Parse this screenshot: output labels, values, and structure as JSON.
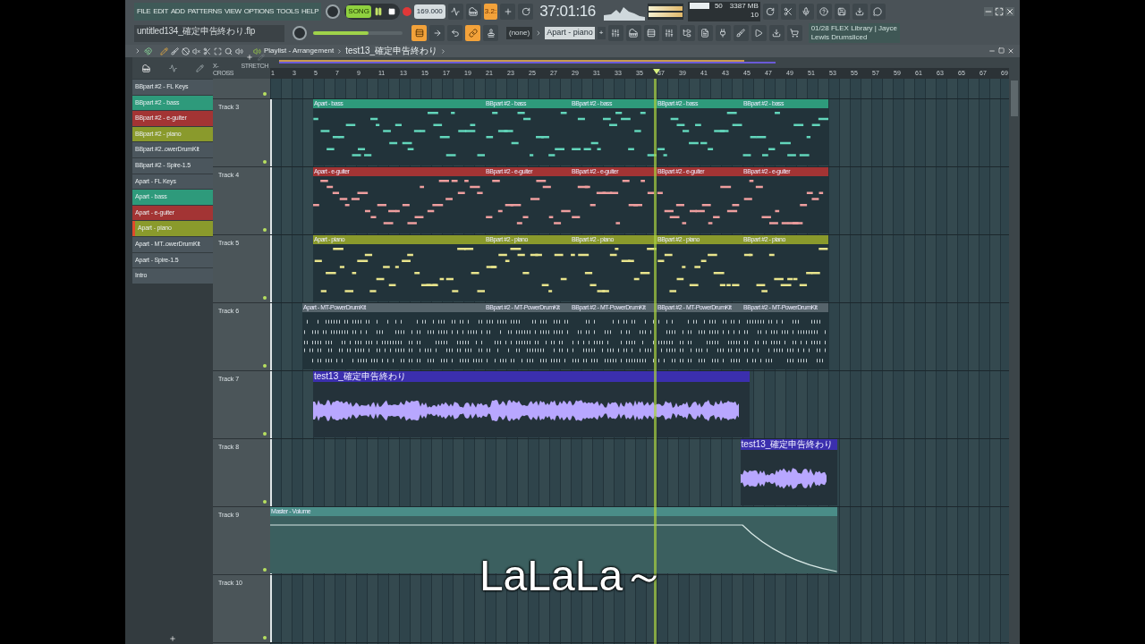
{
  "menu": [
    "FILE",
    "EDIT",
    "ADD",
    "PATTERNS",
    "VIEW",
    "OPTIONS",
    "TOOLS",
    "HELP"
  ],
  "file_name": "untitled134_確定申告終わり.flp",
  "song_mode": "SONG",
  "tempo": "169.000",
  "snap_label": "3.2:",
  "time": "37:01:16",
  "cpu": "50",
  "memory": "3387 MB",
  "polyphony": "10",
  "master_volume": {
    "level": 0.62
  },
  "snap": "(none)",
  "pattern": "Apart - piano",
  "add_pattern": "+",
  "browser_hint": [
    "01/28  FLEX Library | Jayce",
    "Lewis Drumsliced"
  ],
  "playlist": {
    "title": "Playlist - Arrangement",
    "pattern": "test13_確定申告終わり"
  },
  "crossfade": "X-CROSS",
  "stretch": "STRETCH",
  "ruler": [
    "1",
    "3",
    "5",
    "7",
    "9",
    "11",
    "13",
    "15",
    "17",
    "19",
    "21",
    "23",
    "25",
    "27",
    "29",
    "31",
    "33",
    "35",
    "37",
    "39",
    "41",
    "43",
    "45",
    "47",
    "49",
    "51",
    "53",
    "55",
    "57",
    "59",
    "61",
    "63",
    "65",
    "67",
    "69"
  ],
  "patterns": [
    {
      "name": "BBpart #2 - FL Keys",
      "color": "#4b565d",
      "selected": false
    },
    {
      "name": "BBpart #2 - bass",
      "color": "#2e9a7b",
      "selected": false
    },
    {
      "name": "BBpart #2 - e-guiter",
      "color": "#a33434",
      "selected": false
    },
    {
      "name": "BBpart #2 - piano",
      "color": "#8a9a2c",
      "selected": false
    },
    {
      "name": "BBpart #2..owerDrumKit",
      "color": "#4b565d",
      "selected": false
    },
    {
      "name": "BBpart #2 - Spire-1.5",
      "color": "#4b565d",
      "selected": false
    },
    {
      "name": "Apart - FL Keys",
      "color": "#4b565d",
      "selected": false
    },
    {
      "name": "Apart - bass",
      "color": "#2e9a7b",
      "selected": false
    },
    {
      "name": "Apart - e-guiter",
      "color": "#a33434",
      "selected": false
    },
    {
      "name": "Apart - piano",
      "color": "#8a9a2c",
      "selected": true
    },
    {
      "name": "Apart - MT..owerDrumKit",
      "color": "#4b565d",
      "selected": false
    },
    {
      "name": "Apart - Spire-1.5",
      "color": "#4b565d",
      "selected": false
    },
    {
      "name": "Intro",
      "color": "#4b565d",
      "selected": false
    }
  ],
  "tracks": [
    {
      "name": "Track 3",
      "clips": [
        {
          "kind": "notes",
          "label": "Apart - bass",
          "color": "#2e9a7b"
        },
        {
          "kind": "notes",
          "label": "BBpart #2 - bass",
          "color": "#2e9a7b"
        },
        {
          "kind": "notes",
          "label": "BBpart #2 - bass",
          "color": "#2e9a7b"
        },
        {
          "kind": "notes",
          "label": "BBpart #2 - bass",
          "color": "#2e9a7b"
        },
        {
          "kind": "notes",
          "label": "BBpart #2 - bass",
          "color": "#2e9a7b"
        }
      ]
    },
    {
      "name": "Track 4",
      "clips": [
        {
          "kind": "notes",
          "label": "Apart - e-guiter",
          "color": "#a33434"
        },
        {
          "kind": "notes",
          "label": "BBpart #2 - e-guiter",
          "color": "#a33434"
        },
        {
          "kind": "notes",
          "label": "BBpart #2 - e-guiter",
          "color": "#a33434"
        },
        {
          "kind": "notes",
          "label": "BBpart #2 - e-guiter",
          "color": "#a33434"
        },
        {
          "kind": "notes",
          "label": "BBpart #2 - e-guiter",
          "color": "#a33434"
        }
      ]
    },
    {
      "name": "Track 5",
      "clips": [
        {
          "kind": "notes",
          "label": "Apart - piano",
          "color": "#8a9a2c"
        },
        {
          "kind": "notes",
          "label": "BBpart #2 - piano",
          "color": "#8a9a2c"
        },
        {
          "kind": "notes",
          "label": "BBpart #2 - piano",
          "color": "#8a9a2c"
        },
        {
          "kind": "notes",
          "label": "BBpart #2 - piano",
          "color": "#8a9a2c"
        },
        {
          "kind": "notes",
          "label": "BBpart #2 - piano",
          "color": "#8a9a2c"
        }
      ]
    },
    {
      "name": "Track 6",
      "clips": [
        {
          "kind": "drums",
          "label": "Apart - MT-PowerDrumKit",
          "color": "#56646b"
        },
        {
          "kind": "drums",
          "label": "BBpart #2 - MT-PowerDrumKit",
          "color": "#56646b"
        },
        {
          "kind": "drums",
          "label": "BBpart #2 - MT-PowerDrumKit",
          "color": "#56646b"
        },
        {
          "kind": "drums",
          "label": "BBpart #2 - MT-PowerDrumKit",
          "color": "#56646b"
        },
        {
          "kind": "drums",
          "label": "BBpart #2 - MT-PowerDrumKit",
          "color": "#56646b"
        }
      ]
    },
    {
      "name": "Track 7",
      "clips": [
        {
          "kind": "audio",
          "label": "test13_確定申告終わり",
          "color": "#3b2fae"
        }
      ]
    },
    {
      "name": "Track 8",
      "clips": [
        {
          "kind": "audio",
          "label": "test13_確定申告終わり",
          "color": "#3b2fae"
        }
      ]
    },
    {
      "name": "Track 9",
      "clips": [
        {
          "kind": "automation",
          "label": "Master - Volume",
          "color": "#4a8d88"
        }
      ]
    },
    {
      "name": "Track 10"
    }
  ],
  "subtitle": "LaLaLa～"
}
